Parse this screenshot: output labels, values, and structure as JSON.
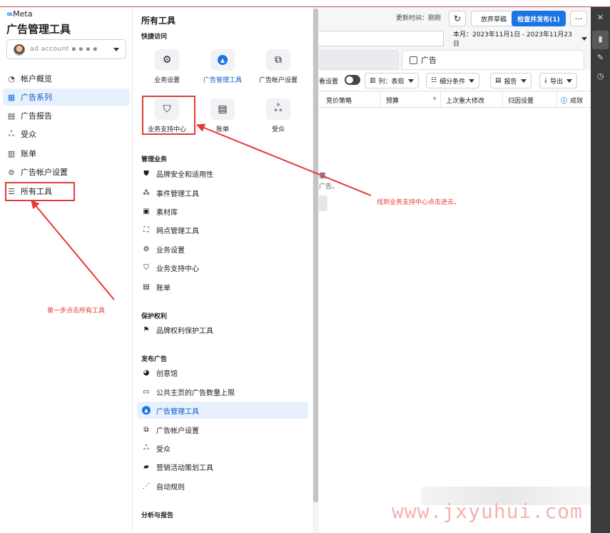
{
  "app": {
    "logo": "Meta",
    "title": "广告管理工具",
    "account_name": "ad account ▪ ▪ ▪ ▪"
  },
  "leftnav": {
    "items": [
      {
        "label": "帐户概览",
        "icon": "gauge-icon"
      },
      {
        "label": "广告系列",
        "icon": "table-icon"
      },
      {
        "label": "广告报告",
        "icon": "report-icon"
      },
      {
        "label": "受众",
        "icon": "people-icon"
      },
      {
        "label": "账单",
        "icon": "billing-icon"
      },
      {
        "label": "广告帐户设置",
        "icon": "settings-icon"
      },
      {
        "label": "所有工具",
        "icon": "menu-icon"
      }
    ]
  },
  "tools": {
    "title": "所有工具",
    "quick_access_header": "快捷访问",
    "quick": [
      {
        "label": "业务设置",
        "icon": "gear-icon"
      },
      {
        "label": "广告管理工具",
        "icon": "ads-manager-icon"
      },
      {
        "label": "广告帐户设置",
        "icon": "account-settings-icon"
      },
      {
        "label": "业务支持中心",
        "icon": "shield-icon"
      },
      {
        "label": "账单",
        "icon": "billing-icon"
      },
      {
        "label": "受众",
        "icon": "people-icon"
      }
    ],
    "manage_header": "管理业务",
    "manage": [
      {
        "label": "品牌安全和适用性",
        "icon": "shield-check-icon"
      },
      {
        "label": "事件管理工具",
        "icon": "network-icon"
      },
      {
        "label": "素材库",
        "icon": "image-icon"
      },
      {
        "label": "网点管理工具",
        "icon": "location-icon"
      },
      {
        "label": "业务设置",
        "icon": "gear-icon"
      },
      {
        "label": "业务支持中心",
        "icon": "shield-icon"
      },
      {
        "label": "账单",
        "icon": "billing-icon"
      }
    ],
    "protect_header": "保护权利",
    "protect": [
      {
        "label": "品牌权利保护工具",
        "icon": "flag-icon"
      }
    ],
    "publish_header": "发布广告",
    "publish": [
      {
        "label": "创意馆",
        "icon": "palette-icon"
      },
      {
        "label": "公共主页的广告数量上限",
        "icon": "page-icon"
      },
      {
        "label": "广告管理工具",
        "icon": "ads-manager-icon"
      },
      {
        "label": "广告帐户设置",
        "icon": "account-settings-icon"
      },
      {
        "label": "受众",
        "icon": "people-icon"
      },
      {
        "label": "营销活动策划工具",
        "icon": "folder-icon"
      },
      {
        "label": "自动规则",
        "icon": "rules-icon"
      }
    ],
    "analyze_header": "分析与报告"
  },
  "main": {
    "updated": "更新时间：刚刚",
    "discard": "放弃草稿",
    "publish": "检查并发布(1)",
    "more": "···",
    "date_range": "本月：2023年11月1日 - 2023年11月23日",
    "tab_ad": "广告",
    "toolbar": {
      "view_settings": "看设置",
      "columns": "列：表现",
      "breakdown": "细分条件",
      "report": "报告",
      "export": "导出"
    },
    "headers": [
      "竞价策略",
      "预算",
      "上次重大修改",
      "归因设置",
      "成效"
    ],
    "frag1": "果",
    "frag2": "广告。"
  },
  "annotations": {
    "step1": "第一步点击所有工具",
    "step2": "找到业务支持中心点击进去。"
  },
  "watermark": "www.jxyuhui.com",
  "colors": {
    "accent": "#1b74e4",
    "annotation": "#e53935"
  }
}
